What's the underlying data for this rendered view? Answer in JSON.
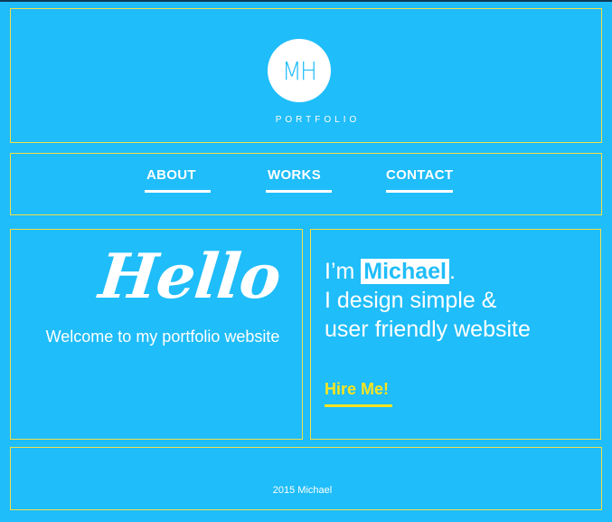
{
  "header": {
    "logo_text": "MH",
    "subtitle": "PORTFOLIO"
  },
  "nav": {
    "items": [
      {
        "label": "ABOUT"
      },
      {
        "label": "WORKS"
      },
      {
        "label": "CONTACT"
      }
    ]
  },
  "hero": {
    "greeting": "Hello",
    "welcome": "Welcome to my portfolio website",
    "intro_prefix": "I’m",
    "name": "Michael",
    "intro_punct": ".",
    "line2": "I design simple &",
    "line3": "user friendly website",
    "cta_label": "Hire Me!"
  },
  "footer": {
    "text": "2015 Michael"
  },
  "colors": {
    "background": "#1fbdf9",
    "panel_border": "#f2e14a",
    "accent": "#f7e51f",
    "text": "#ffffff"
  }
}
